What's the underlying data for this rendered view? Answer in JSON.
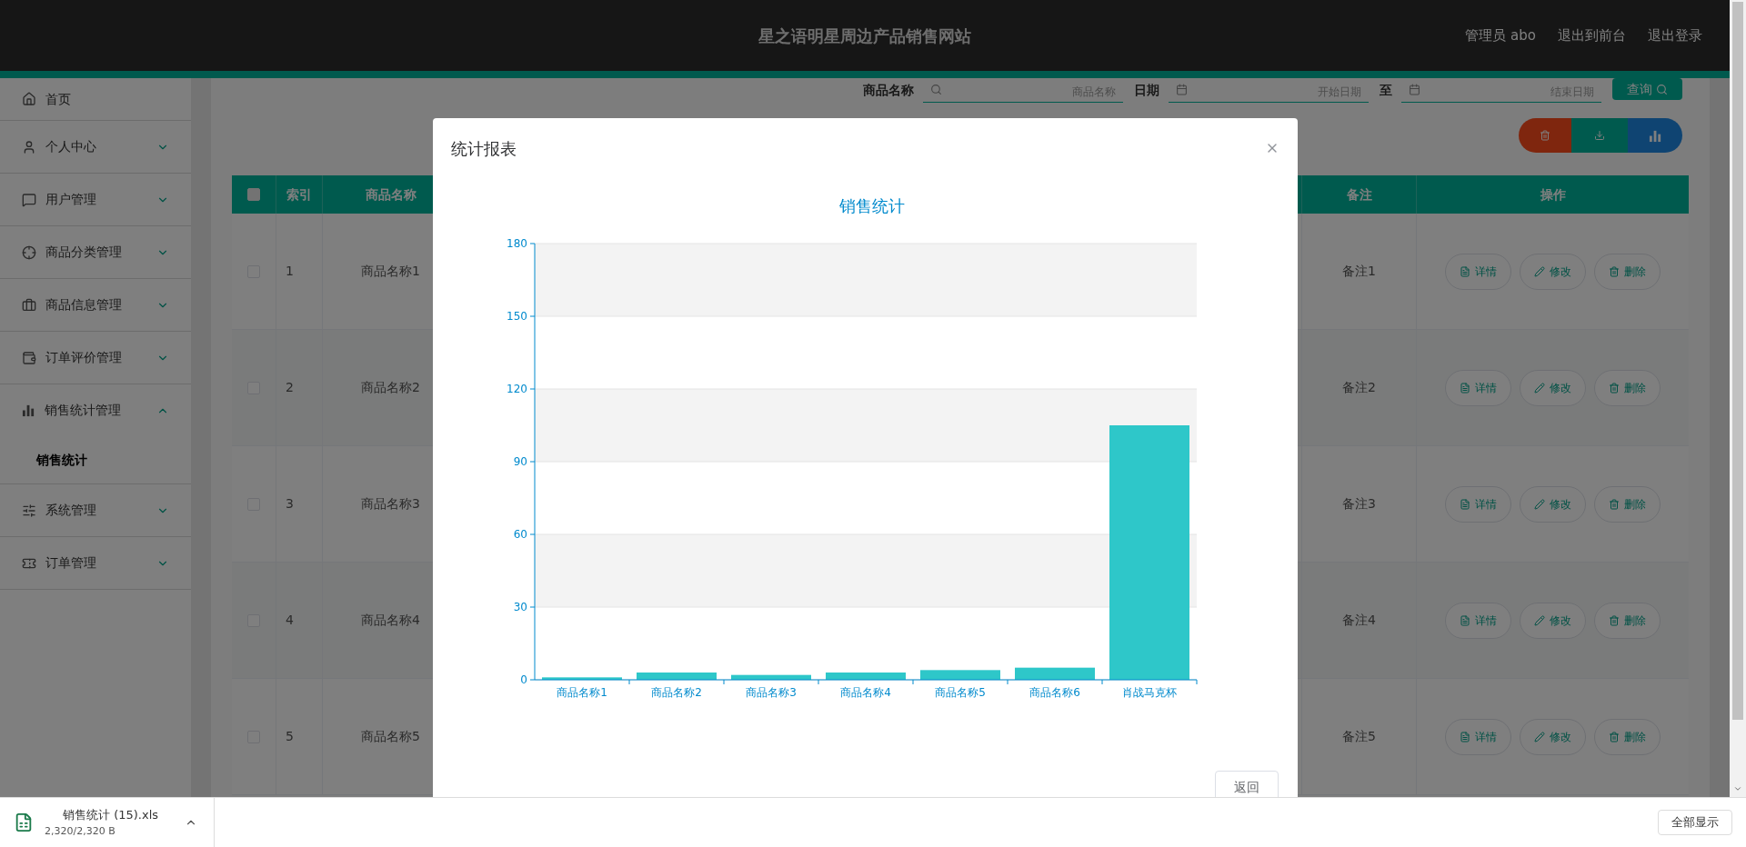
{
  "header": {
    "title": "星之语明星周边产品销售网站",
    "links": [
      "管理员 abo",
      "退出到前台",
      "退出登录"
    ]
  },
  "sidebar": {
    "items": [
      {
        "label": "首页",
        "kind": "link"
      },
      {
        "label": "个人中心",
        "kind": "menu",
        "expanded": false
      },
      {
        "label": "用户管理",
        "kind": "menu",
        "expanded": false
      },
      {
        "label": "商品分类管理",
        "kind": "menu",
        "expanded": false
      },
      {
        "label": "商品信息管理",
        "kind": "menu",
        "expanded": false
      },
      {
        "label": "订单评价管理",
        "kind": "menu",
        "expanded": false
      },
      {
        "label": "销售统计管理",
        "kind": "menu",
        "expanded": true,
        "children": [
          {
            "label": "销售统计",
            "selected": true
          }
        ]
      },
      {
        "label": "系统管理",
        "kind": "menu",
        "expanded": false
      },
      {
        "label": "订单管理",
        "kind": "menu",
        "expanded": false
      }
    ]
  },
  "search": {
    "fields": [
      {
        "label": "商品名称",
        "placeholder": "商品名称"
      },
      {
        "label": "日期",
        "placeholder": "开始日期"
      },
      {
        "label": "至",
        "placeholder": "结束日期"
      }
    ],
    "button": "查询"
  },
  "table": {
    "select_all": {
      "checked": false
    },
    "columns": [
      "索引",
      "商品名称",
      "备注",
      "操作"
    ],
    "rows": [
      {
        "checked": false,
        "index": "1",
        "name": "商品名称1",
        "remark": "备注1",
        "actions": [
          {
            "kind": "detail",
            "label": "详情"
          },
          {
            "kind": "edit",
            "label": "修改"
          },
          {
            "kind": "delete",
            "label": "删除"
          }
        ]
      },
      {
        "checked": false,
        "index": "2",
        "name": "商品名称2",
        "remark": "备注2",
        "actions": [
          {
            "kind": "detail",
            "label": "详情"
          },
          {
            "kind": "edit",
            "label": "修改"
          },
          {
            "kind": "delete",
            "label": "删除"
          }
        ]
      },
      {
        "checked": false,
        "index": "3",
        "name": "商品名称3",
        "remark": "备注3",
        "actions": [
          {
            "kind": "detail",
            "label": "详情"
          },
          {
            "kind": "edit",
            "label": "修改"
          },
          {
            "kind": "delete",
            "label": "删除"
          }
        ]
      },
      {
        "checked": false,
        "index": "4",
        "name": "商品名称4",
        "remark": "备注4",
        "actions": [
          {
            "kind": "detail",
            "label": "详情"
          },
          {
            "kind": "edit",
            "label": "修改"
          },
          {
            "kind": "delete",
            "label": "删除"
          }
        ]
      },
      {
        "checked": false,
        "index": "5",
        "name": "商品名称5",
        "remark": "备注5",
        "actions": [
          {
            "kind": "detail",
            "label": "详情"
          },
          {
            "kind": "edit",
            "label": "修改"
          },
          {
            "kind": "delete",
            "label": "删除"
          }
        ]
      }
    ]
  },
  "modal": {
    "title": "统计报表",
    "button": "返回",
    "chart_data": {
      "type": "bar",
      "title": "销售统计",
      "categories": [
        "商品名称1",
        "商品名称2",
        "商品名称3",
        "商品名称4",
        "商品名称5",
        "商品名称6",
        "肖战马克杯"
      ],
      "values": [
        1,
        3,
        2,
        3,
        4,
        5,
        105
      ],
      "grid": true,
      "ylim": [
        0,
        180
      ],
      "yticks": [
        0,
        30,
        60,
        90,
        120,
        150,
        180
      ]
    }
  },
  "download_bar": {
    "file": "销售统计 (15).xls",
    "progress": "2,320/2,320 B",
    "show_all": "全部显示"
  }
}
